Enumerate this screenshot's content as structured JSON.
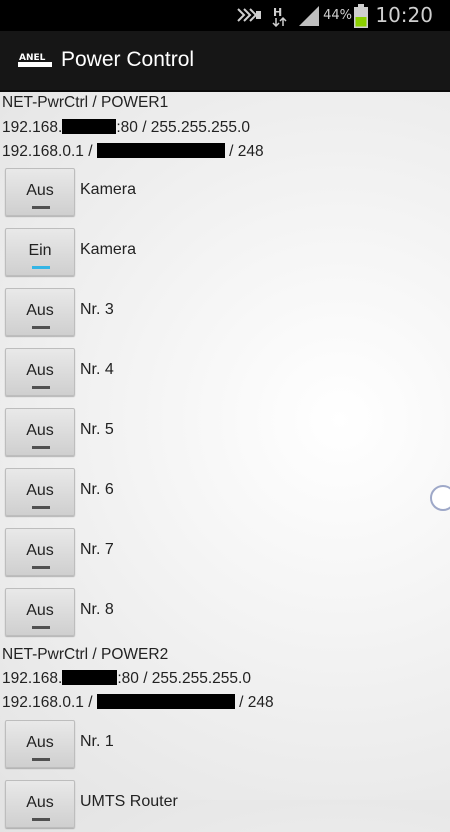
{
  "status_bar": {
    "battery_percent": "44%",
    "time": "10:20",
    "icons": [
      "usb-debug-icon",
      "h-data-icon",
      "signal-icon",
      "battery-icon"
    ]
  },
  "action_bar": {
    "title": "Power Control",
    "logo": "anel-logo"
  },
  "groups": [
    {
      "device": "NET-PwrCtrl / POWER1",
      "ip_prefix": "192.168.",
      "ip_suffix": ":80 / 255.255.255.0",
      "gateway_prefix": "192.168.0.1 / ",
      "gateway_suffix": "/ 248",
      "switches": [
        {
          "state": "Aus",
          "label": "Kamera"
        },
        {
          "state": "Ein",
          "label": "Kamera"
        },
        {
          "state": "Aus",
          "label": "Nr. 3"
        },
        {
          "state": "Aus",
          "label": "Nr. 4"
        },
        {
          "state": "Aus",
          "label": "Nr. 5"
        },
        {
          "state": "Aus",
          "label": "Nr. 6"
        },
        {
          "state": "Aus",
          "label": "Nr. 7"
        },
        {
          "state": "Aus",
          "label": "Nr. 8"
        }
      ]
    },
    {
      "device": "NET-PwrCtrl / POWER2",
      "ip_prefix": "192.168.",
      "ip_suffix": ":80 / 255.255.255.0",
      "gateway_prefix": "192.168.0.1 / ",
      "gateway_suffix": " / 248",
      "switches": [
        {
          "state": "Aus",
          "label": "Nr. 1"
        },
        {
          "state": "Aus",
          "label": "UMTS Router"
        }
      ]
    }
  ],
  "colors": {
    "on_indicator": "#33b5e5",
    "off_indicator": "#505050",
    "action_bar": "#161616"
  }
}
